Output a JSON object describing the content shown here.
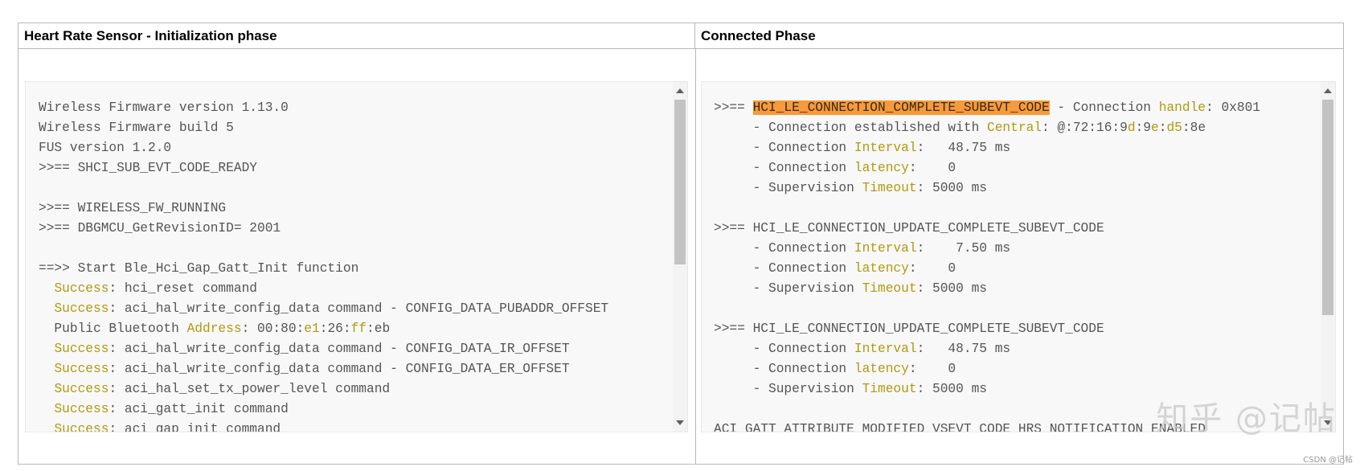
{
  "headers": {
    "left": "Heart Rate Sensor - Initialization phase",
    "right": "Connected Phase"
  },
  "left_log": [
    [
      {
        "t": "Wireless Firmware version 1.13.0"
      }
    ],
    [
      {
        "t": "Wireless Firmware build 5"
      }
    ],
    [
      {
        "t": "FUS version 1.2.0"
      }
    ],
    [
      {
        "t": ">>== SHCI_SUB_EVT_CODE_READY"
      }
    ],
    [
      {
        "t": ""
      }
    ],
    [
      {
        "t": ">>== WIRELESS_FW_RUNNING"
      }
    ],
    [
      {
        "t": ">>== DBGMCU_GetRevisionID= 2001"
      }
    ],
    [
      {
        "t": ""
      }
    ],
    [
      {
        "t": "==>> Start Ble_Hci_Gap_Gatt_Init function"
      }
    ],
    [
      {
        "t": "  "
      },
      {
        "t": "Success",
        "c": "y"
      },
      {
        "t": ": hci_reset command"
      }
    ],
    [
      {
        "t": "  "
      },
      {
        "t": "Success",
        "c": "y"
      },
      {
        "t": ": aci_hal_write_config_data command - CONFIG_DATA_PUBADDR_OFFSET"
      }
    ],
    [
      {
        "t": "  Public Bluetooth "
      },
      {
        "t": "Address",
        "c": "y"
      },
      {
        "t": ": 00:80:"
      },
      {
        "t": "e1",
        "c": "y"
      },
      {
        "t": ":26:"
      },
      {
        "t": "ff",
        "c": "y"
      },
      {
        "t": ":eb"
      }
    ],
    [
      {
        "t": "  "
      },
      {
        "t": "Success",
        "c": "y"
      },
      {
        "t": ": aci_hal_write_config_data command - CONFIG_DATA_IR_OFFSET"
      }
    ],
    [
      {
        "t": "  "
      },
      {
        "t": "Success",
        "c": "y"
      },
      {
        "t": ": aci_hal_write_config_data command - CONFIG_DATA_ER_OFFSET"
      }
    ],
    [
      {
        "t": "  "
      },
      {
        "t": "Success",
        "c": "y"
      },
      {
        "t": ": aci_hal_set_tx_power_level command"
      }
    ],
    [
      {
        "t": "  "
      },
      {
        "t": "Success",
        "c": "y"
      },
      {
        "t": ": aci_gatt_init command"
      }
    ],
    [
      {
        "t": "  "
      },
      {
        "t": "Success",
        "c": "y"
      },
      {
        "t": ": aci_gap_init command"
      }
    ]
  ],
  "right_log": [
    [
      {
        "t": ">>== "
      },
      {
        "t": "HCI_LE_CONNECTION_COMPLETE_SUBEVT_CODE",
        "c": "sel"
      },
      {
        "t": " - Connection "
      },
      {
        "t": "handle",
        "c": "y"
      },
      {
        "t": ": 0x801"
      }
    ],
    [
      {
        "t": "     - Connection established with "
      },
      {
        "t": "Central",
        "c": "y"
      },
      {
        "t": ": @:72:16:9"
      },
      {
        "t": "d",
        "c": "y"
      },
      {
        "t": ":9"
      },
      {
        "t": "e",
        "c": "y"
      },
      {
        "t": ":"
      },
      {
        "t": "d5",
        "c": "y"
      },
      {
        "t": ":8e"
      }
    ],
    [
      {
        "t": "     - Connection "
      },
      {
        "t": "Interval",
        "c": "y"
      },
      {
        "t": ":   48.75 ms"
      }
    ],
    [
      {
        "t": "     - Connection "
      },
      {
        "t": "latency",
        "c": "y"
      },
      {
        "t": ":    0"
      }
    ],
    [
      {
        "t": "     - Supervision "
      },
      {
        "t": "Timeout",
        "c": "y"
      },
      {
        "t": ": 5000 ms"
      }
    ],
    [
      {
        "t": ""
      }
    ],
    [
      {
        "t": ">>== HCI_LE_CONNECTION_UPDATE_COMPLETE_SUBEVT_CODE"
      }
    ],
    [
      {
        "t": "     - Connection "
      },
      {
        "t": "Interval",
        "c": "y"
      },
      {
        "t": ":    7.50 ms"
      }
    ],
    [
      {
        "t": "     - Connection "
      },
      {
        "t": "latency",
        "c": "y"
      },
      {
        "t": ":    0"
      }
    ],
    [
      {
        "t": "     - Supervision "
      },
      {
        "t": "Timeout",
        "c": "y"
      },
      {
        "t": ": 5000 ms"
      }
    ],
    [
      {
        "t": ""
      }
    ],
    [
      {
        "t": ">>== HCI_LE_CONNECTION_UPDATE_COMPLETE_SUBEVT_CODE"
      }
    ],
    [
      {
        "t": "     - Connection "
      },
      {
        "t": "Interval",
        "c": "y"
      },
      {
        "t": ":   48.75 ms"
      }
    ],
    [
      {
        "t": "     - Connection "
      },
      {
        "t": "latency",
        "c": "y"
      },
      {
        "t": ":    0"
      }
    ],
    [
      {
        "t": "     - Supervision "
      },
      {
        "t": "Timeout",
        "c": "y"
      },
      {
        "t": ": 5000 ms"
      }
    ],
    [
      {
        "t": ""
      }
    ],
    [
      {
        "t": "ACI_GATT_ATTRIBUTE_MODIFIED_VSEVT_CODE HRS_NOTIFICATION_ENABLED"
      }
    ]
  ],
  "watermark": "知乎 @记帖",
  "csdn_mark": "CSDN @记帖",
  "colors": {
    "keyword": "#b09a10",
    "selection": "#f79a3b",
    "text": "#555555"
  }
}
